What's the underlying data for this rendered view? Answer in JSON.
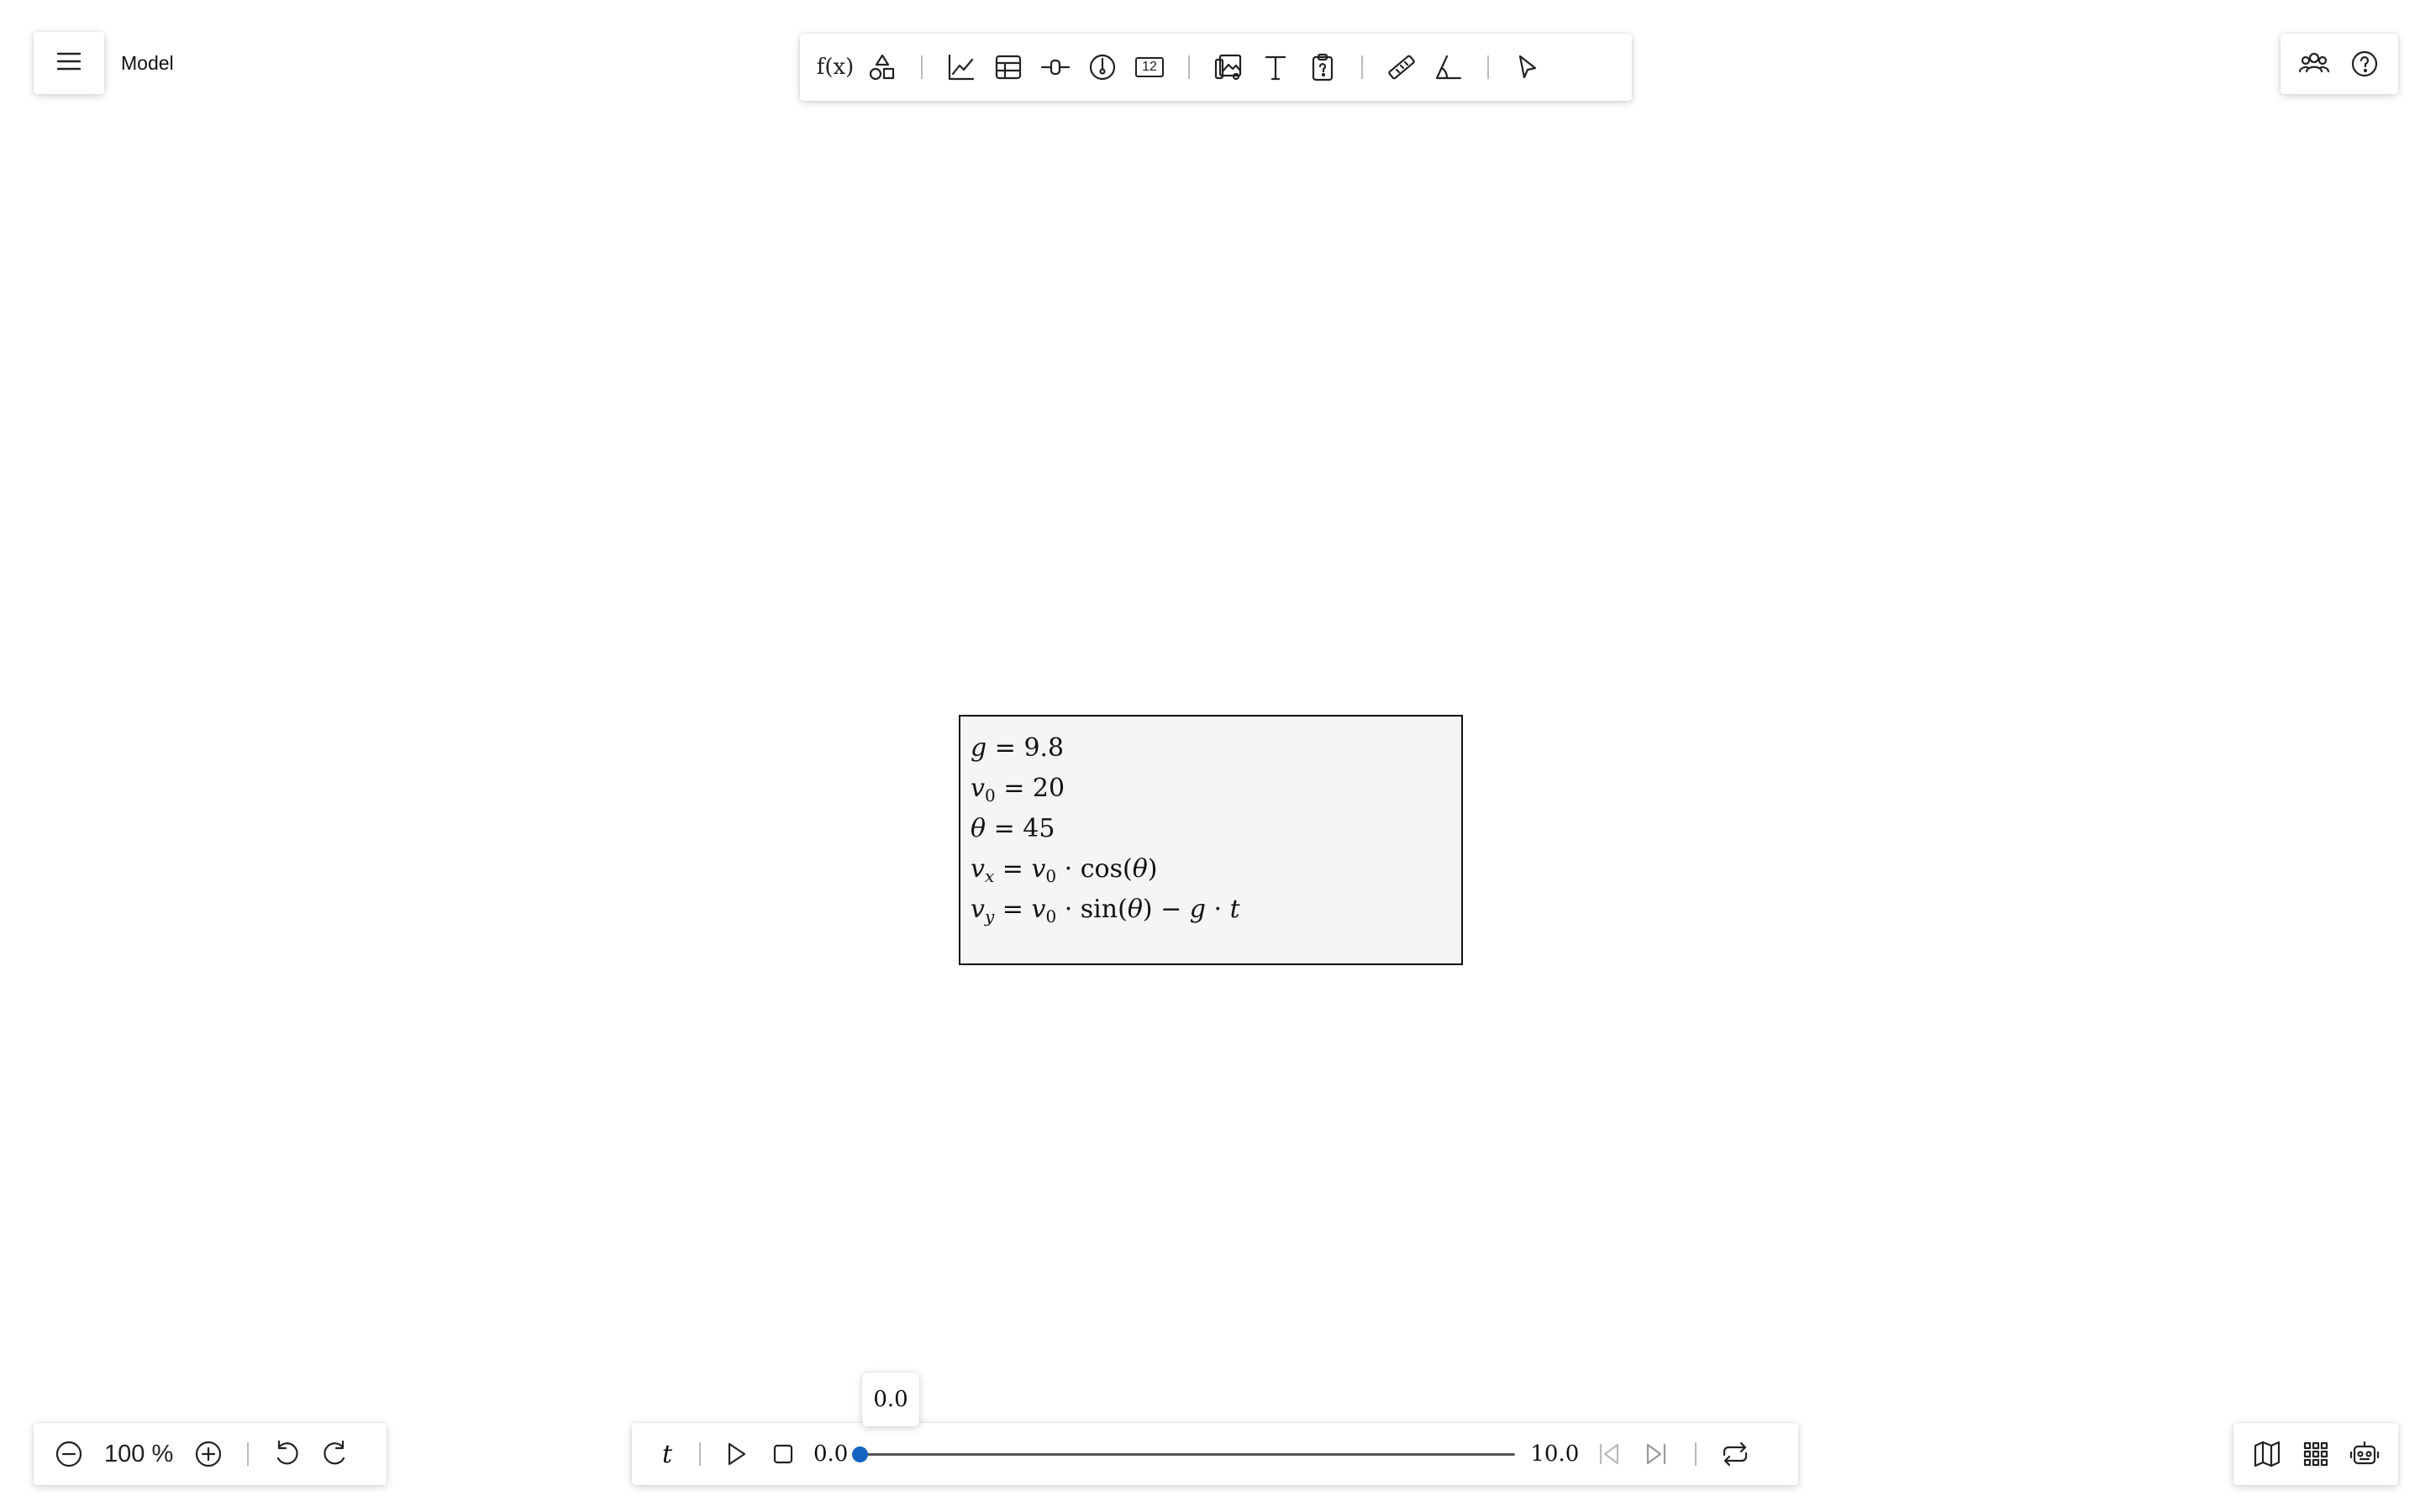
{
  "document": {
    "title": "Model"
  },
  "toolbar": {
    "groups": [
      [
        "function-icon",
        "shapes-icon"
      ],
      [
        "graph-icon",
        "table-icon",
        "slider-icon",
        "gauge-icon",
        "number-icon"
      ],
      [
        "images-icon",
        "text-icon",
        "clipboard-question-icon"
      ],
      [
        "ruler-icon",
        "protractor-icon"
      ],
      [
        "pointer-icon"
      ]
    ],
    "function_label": "f(x)",
    "number_label": "12"
  },
  "top_right": {
    "icons": [
      "collaborators-icon",
      "help-icon"
    ]
  },
  "equations": {
    "line1": {
      "lhs": "g",
      "rhs": "9.8"
    },
    "line2": {
      "lhs": "v",
      "lhs_sub": "0",
      "rhs": "20"
    },
    "line3": {
      "lhs": "θ",
      "rhs": "45"
    },
    "line4": {
      "lhs": "v",
      "lhs_sub": "x",
      "rhs_a": "v",
      "rhs_a_sub": "0",
      "func": "cos",
      "arg": "θ"
    },
    "line5": {
      "lhs": "v",
      "lhs_sub": "y",
      "rhs_a": "v",
      "rhs_a_sub": "0",
      "func": "sin",
      "arg": "θ",
      "rhs_b": "g",
      "rhs_c": "t"
    }
  },
  "zoom": {
    "value": "100 %"
  },
  "animation": {
    "variable": "t",
    "start": "0.0",
    "end": "10.0",
    "current": "0.0",
    "progress": 0
  },
  "bottom_right": {
    "icons": [
      "map-icon",
      "grid-icon",
      "robot-icon"
    ]
  },
  "colors": {
    "accent": "#1565c0"
  }
}
